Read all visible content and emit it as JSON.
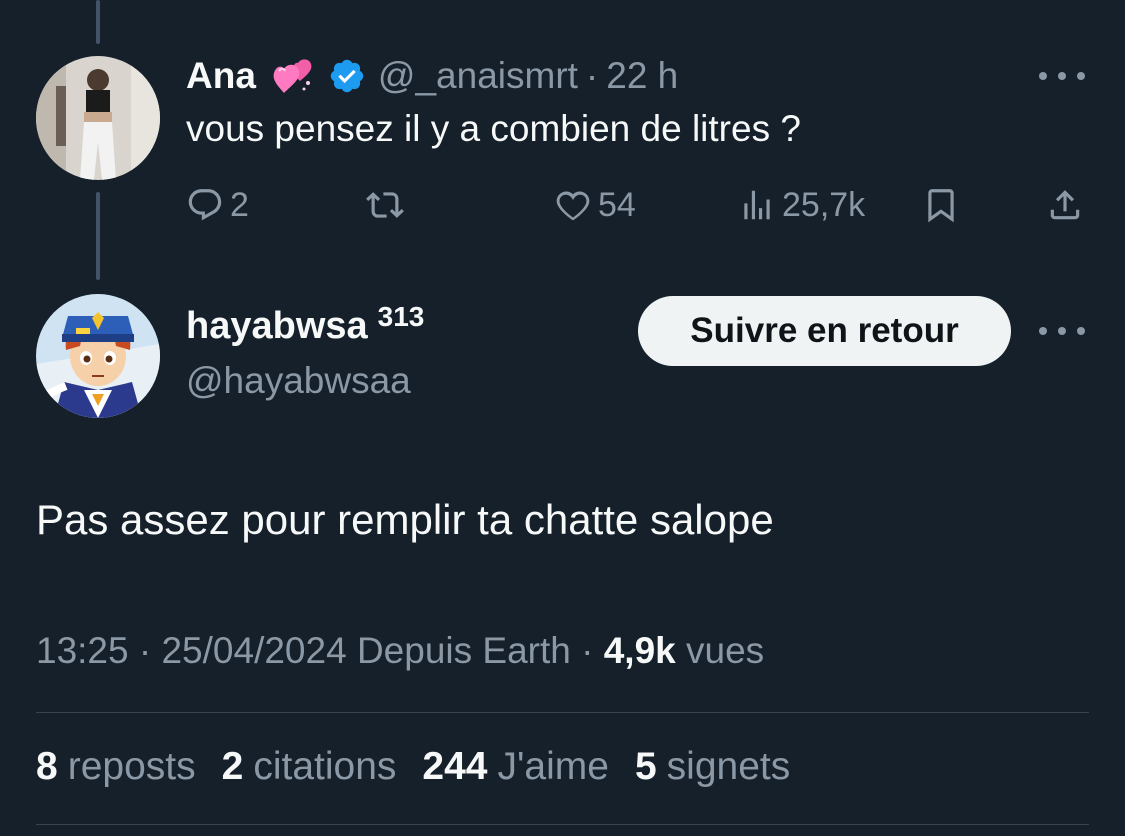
{
  "parent_tweet": {
    "author_name": "Ana",
    "author_emoji": "heart-emoji",
    "verified": true,
    "handle": "@_anaismrt",
    "separator": "·",
    "time": "22 h",
    "text": "vous pensez il y a combien de litres ?",
    "actions": {
      "replies": "2",
      "retweets": "",
      "likes": "54",
      "views": "25,7k"
    }
  },
  "reply_tweet": {
    "author_name": "hayabwsa",
    "badge_number": "313",
    "handle": "@hayabwsaa",
    "follow_button_label": "Suivre en retour",
    "text": "Pas assez pour remplir ta chatte salope",
    "meta": {
      "time": "13:25",
      "sep1": "·",
      "date": "25/04/2024",
      "source": "Depuis Earth",
      "sep2": "·",
      "views_count": "4,9k",
      "views_label": "vues"
    },
    "stats": [
      {
        "count": "8",
        "label": "reposts"
      },
      {
        "count": "2",
        "label": "citations"
      },
      {
        "count": "244",
        "label": "J'aime"
      },
      {
        "count": "5",
        "label": "signets"
      }
    ]
  },
  "colors": {
    "background": "#15202b",
    "text_primary": "#f7f9f9",
    "text_secondary": "#8b98a5",
    "verified_blue": "#1d9bf0",
    "divider": "#38444d"
  }
}
